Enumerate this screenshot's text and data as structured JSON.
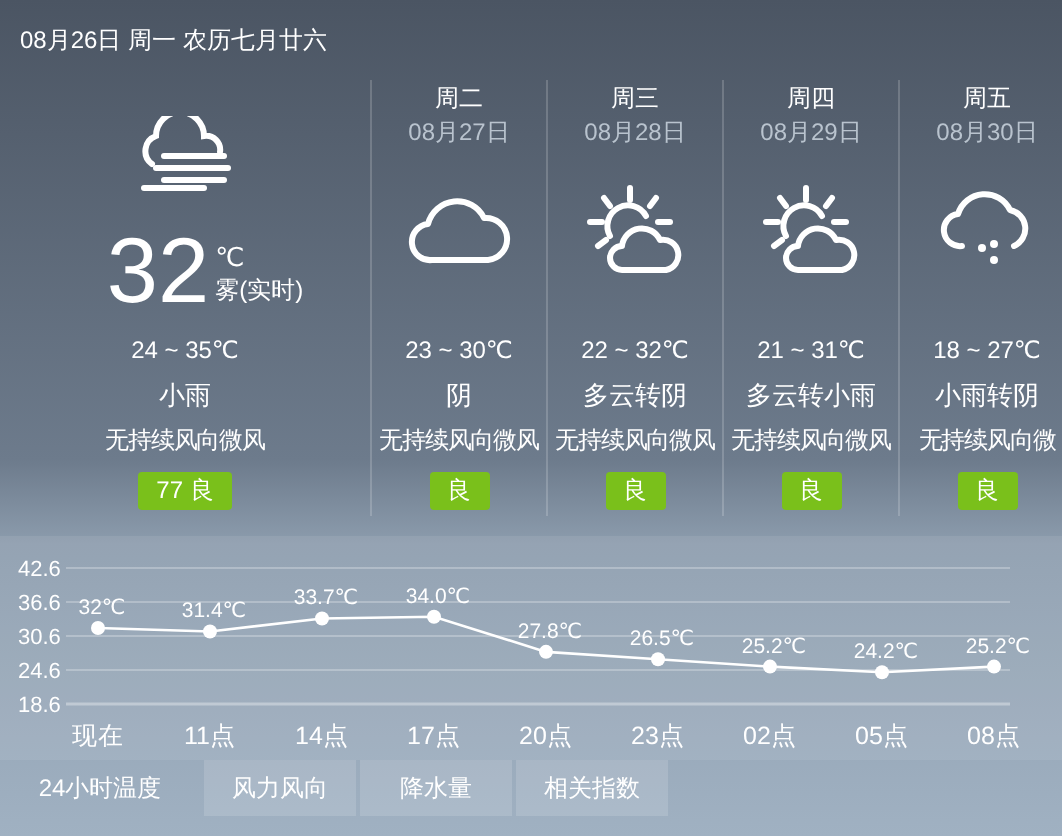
{
  "header": {
    "date": "08月26日 周一 农历七月廿六"
  },
  "today": {
    "kind": "fog",
    "temp": "32",
    "unit": "℃",
    "condition": "雾(实时)",
    "range": "24 ~ 35℃",
    "weather": "小雨",
    "wind": "无持续风向微风",
    "aqi": "77 良"
  },
  "forecast": [
    {
      "weekday": "周二",
      "date": "08月27日",
      "kind": "overcast",
      "range": "23 ~ 30℃",
      "weather": "阴",
      "wind": "无持续风向微风",
      "aqi": "良"
    },
    {
      "weekday": "周三",
      "date": "08月28日",
      "kind": "partly-cloudy",
      "range": "22 ~ 32℃",
      "weather": "多云转阴",
      "wind": "无持续风向微风",
      "aqi": "良"
    },
    {
      "weekday": "周四",
      "date": "08月29日",
      "kind": "partly-cloudy",
      "range": "21 ~ 31℃",
      "weather": "多云转小雨",
      "wind": "无持续风向微风",
      "aqi": "良"
    },
    {
      "weekday": "周五",
      "date": "08月30日",
      "kind": "rain",
      "range": "18 ~ 27℃",
      "weather": "小雨转阴",
      "wind": "无持续风向微",
      "aqi": "良"
    }
  ],
  "chart_data": {
    "type": "line",
    "categories": [
      "现在",
      "11点",
      "14点",
      "17点",
      "20点",
      "23点",
      "02点",
      "05点",
      "08点"
    ],
    "series": [
      {
        "color": "#ffffff",
        "marker": true,
        "values": [
          32,
          31.4,
          33.7,
          34.0,
          27.8,
          26.5,
          25.2,
          24.2,
          25.2
        ]
      }
    ],
    "grid": true,
    "value_labels": [
      "32℃",
      "31.4℃",
      "33.7℃",
      "34.0℃",
      "27.8℃",
      "26.5℃",
      "25.2℃",
      "24.2℃",
      "25.2℃"
    ],
    "ylim": [
      18.6,
      42.6
    ],
    "yticks": [
      18.6,
      24.6,
      30.6,
      36.6,
      42.6
    ]
  },
  "tabs": [
    {
      "label": "24小时温度",
      "selected": true
    },
    {
      "label": "风力风向",
      "selected": false
    },
    {
      "label": "降水量",
      "selected": false
    },
    {
      "label": "相关指数",
      "selected": false
    }
  ]
}
